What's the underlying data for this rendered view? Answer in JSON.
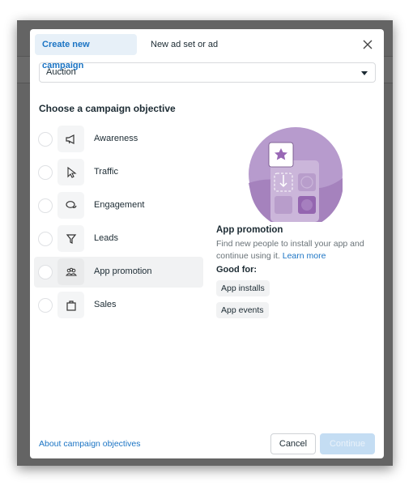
{
  "tabs": [
    {
      "label": "Create new campaign",
      "active": true
    },
    {
      "label": "New ad set or ad",
      "active": false
    }
  ],
  "buying_type": {
    "selected": "Auction"
  },
  "section_heading": "Choose a campaign objective",
  "objectives": [
    {
      "label": "Awareness",
      "icon": "megaphone-icon",
      "selected": false
    },
    {
      "label": "Traffic",
      "icon": "cursor-icon",
      "selected": false
    },
    {
      "label": "Engagement",
      "icon": "chat-bubbles-icon",
      "selected": false
    },
    {
      "label": "Leads",
      "icon": "funnel-icon",
      "selected": false
    },
    {
      "label": "App promotion",
      "icon": "people-icon",
      "selected": true
    },
    {
      "label": "Sales",
      "icon": "shopping-bag-icon",
      "selected": false
    }
  ],
  "detail": {
    "title": "App promotion",
    "description": "Find new people to install your app and continue using it.",
    "learn_more": "Learn more",
    "good_for_label": "Good for:",
    "good_for": [
      "App installs",
      "App events"
    ]
  },
  "footer": {
    "about_link": "About campaign objectives",
    "cancel": "Cancel",
    "continue": "Continue"
  },
  "colors": {
    "accent": "#1b74c4",
    "illustration": "#a982c0"
  }
}
